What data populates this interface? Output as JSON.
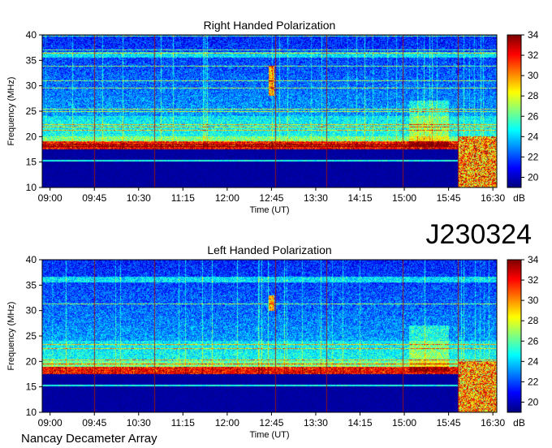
{
  "header": {
    "id_label": "J230324"
  },
  "footer": {
    "label": "Nancay Decameter Array"
  },
  "chart_data": [
    {
      "type": "heatmap",
      "title": "Right Handed Polarization",
      "xlabel": "Time (UT)",
      "ylabel": "Frequency (MHz)",
      "x_ticks": [
        "09:00",
        "09:45",
        "10:30",
        "11:15",
        "12:00",
        "12:45",
        "13:30",
        "14:15",
        "15:00",
        "15:45",
        "16:30"
      ],
      "y_ticks": [
        10,
        15,
        20,
        25,
        30,
        35,
        40
      ],
      "xlim": [
        "08:52",
        "16:34"
      ],
      "ylim": [
        10,
        40
      ],
      "colorbar": {
        "label": "dB",
        "ticks": [
          20,
          22,
          24,
          26,
          28,
          30,
          32,
          34
        ],
        "range": [
          19,
          34
        ]
      },
      "features": {
        "quiet_band_below_mhz": 17.5,
        "burst_near": {
          "time": "12:45",
          "freq_mhz": [
            28,
            34
          ]
        },
        "late_activity_from": "15:55"
      }
    },
    {
      "type": "heatmap",
      "title": "Left Handed Polarization",
      "xlabel": "Time (UT)",
      "ylabel": "Frequency (MHz)",
      "x_ticks": [
        "09:00",
        "09:45",
        "10:30",
        "11:15",
        "12:00",
        "12:45",
        "13:30",
        "14:15",
        "15:00",
        "15:45",
        "16:30"
      ],
      "y_ticks": [
        10,
        15,
        20,
        25,
        30,
        35,
        40
      ],
      "xlim": [
        "08:52",
        "16:34"
      ],
      "ylim": [
        10,
        40
      ],
      "colorbar": {
        "label": "dB",
        "ticks": [
          20,
          22,
          24,
          26,
          28,
          30,
          32,
          34
        ],
        "range": [
          19,
          34
        ]
      },
      "features": {
        "quiet_band_below_mhz": 17.5,
        "burst_near": {
          "time": "12:45",
          "freq_mhz": [
            30,
            33
          ]
        },
        "late_activity_from": "15:55"
      }
    }
  ]
}
